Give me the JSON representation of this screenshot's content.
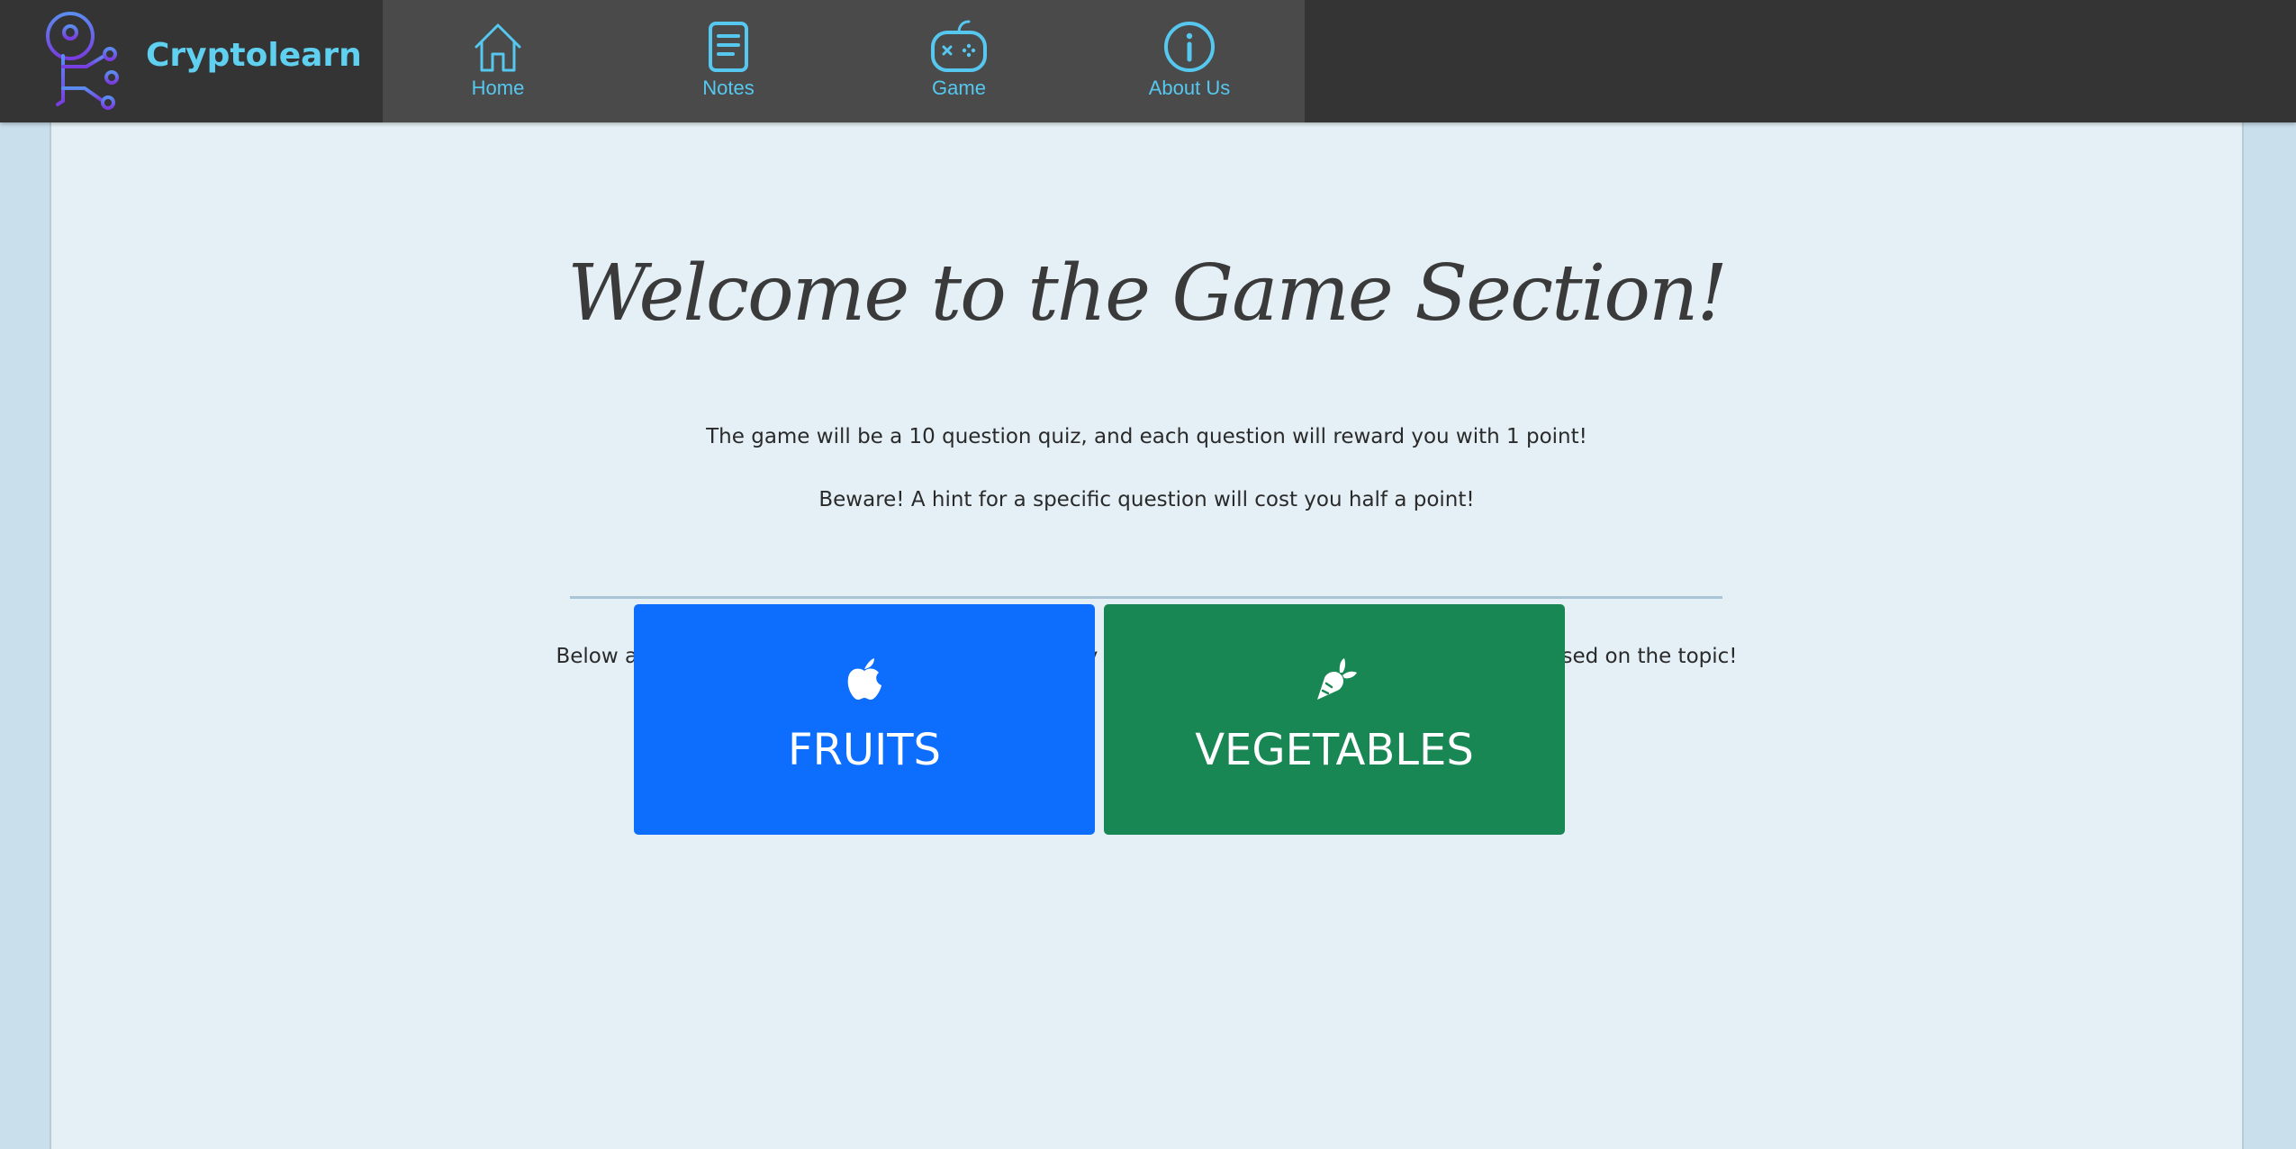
{
  "brand": {
    "name": "Cryptolearn",
    "logo_icon": "key-circuit-logo",
    "color": "#5fd0f0"
  },
  "nav": {
    "items": [
      {
        "label": "Home",
        "icon": "home-icon"
      },
      {
        "label": "Notes",
        "icon": "notes-icon"
      },
      {
        "label": "Game",
        "icon": "gamepad-icon"
      },
      {
        "label": "About Us",
        "icon": "info-icon"
      }
    ],
    "link_color": "#56c8f0",
    "bar_color": "#343434"
  },
  "main": {
    "title": "Welcome to the Game Section!",
    "intro_1": "The game will be a 10 question quiz, and each question will reward you with 1 point!",
    "intro_2": "Beware! A hint for a specific question will cost you half a point!",
    "topics_text": "Below are the 2 topics available for the quizzes, any encrypted or decrypted questions will be based on the topic!",
    "topics": [
      {
        "label": "FRUITS",
        "icon": "apple-icon",
        "color": "#0d6efd"
      },
      {
        "label": "VEGETABLES",
        "icon": "carrot-icon",
        "color": "#198754"
      }
    ]
  }
}
